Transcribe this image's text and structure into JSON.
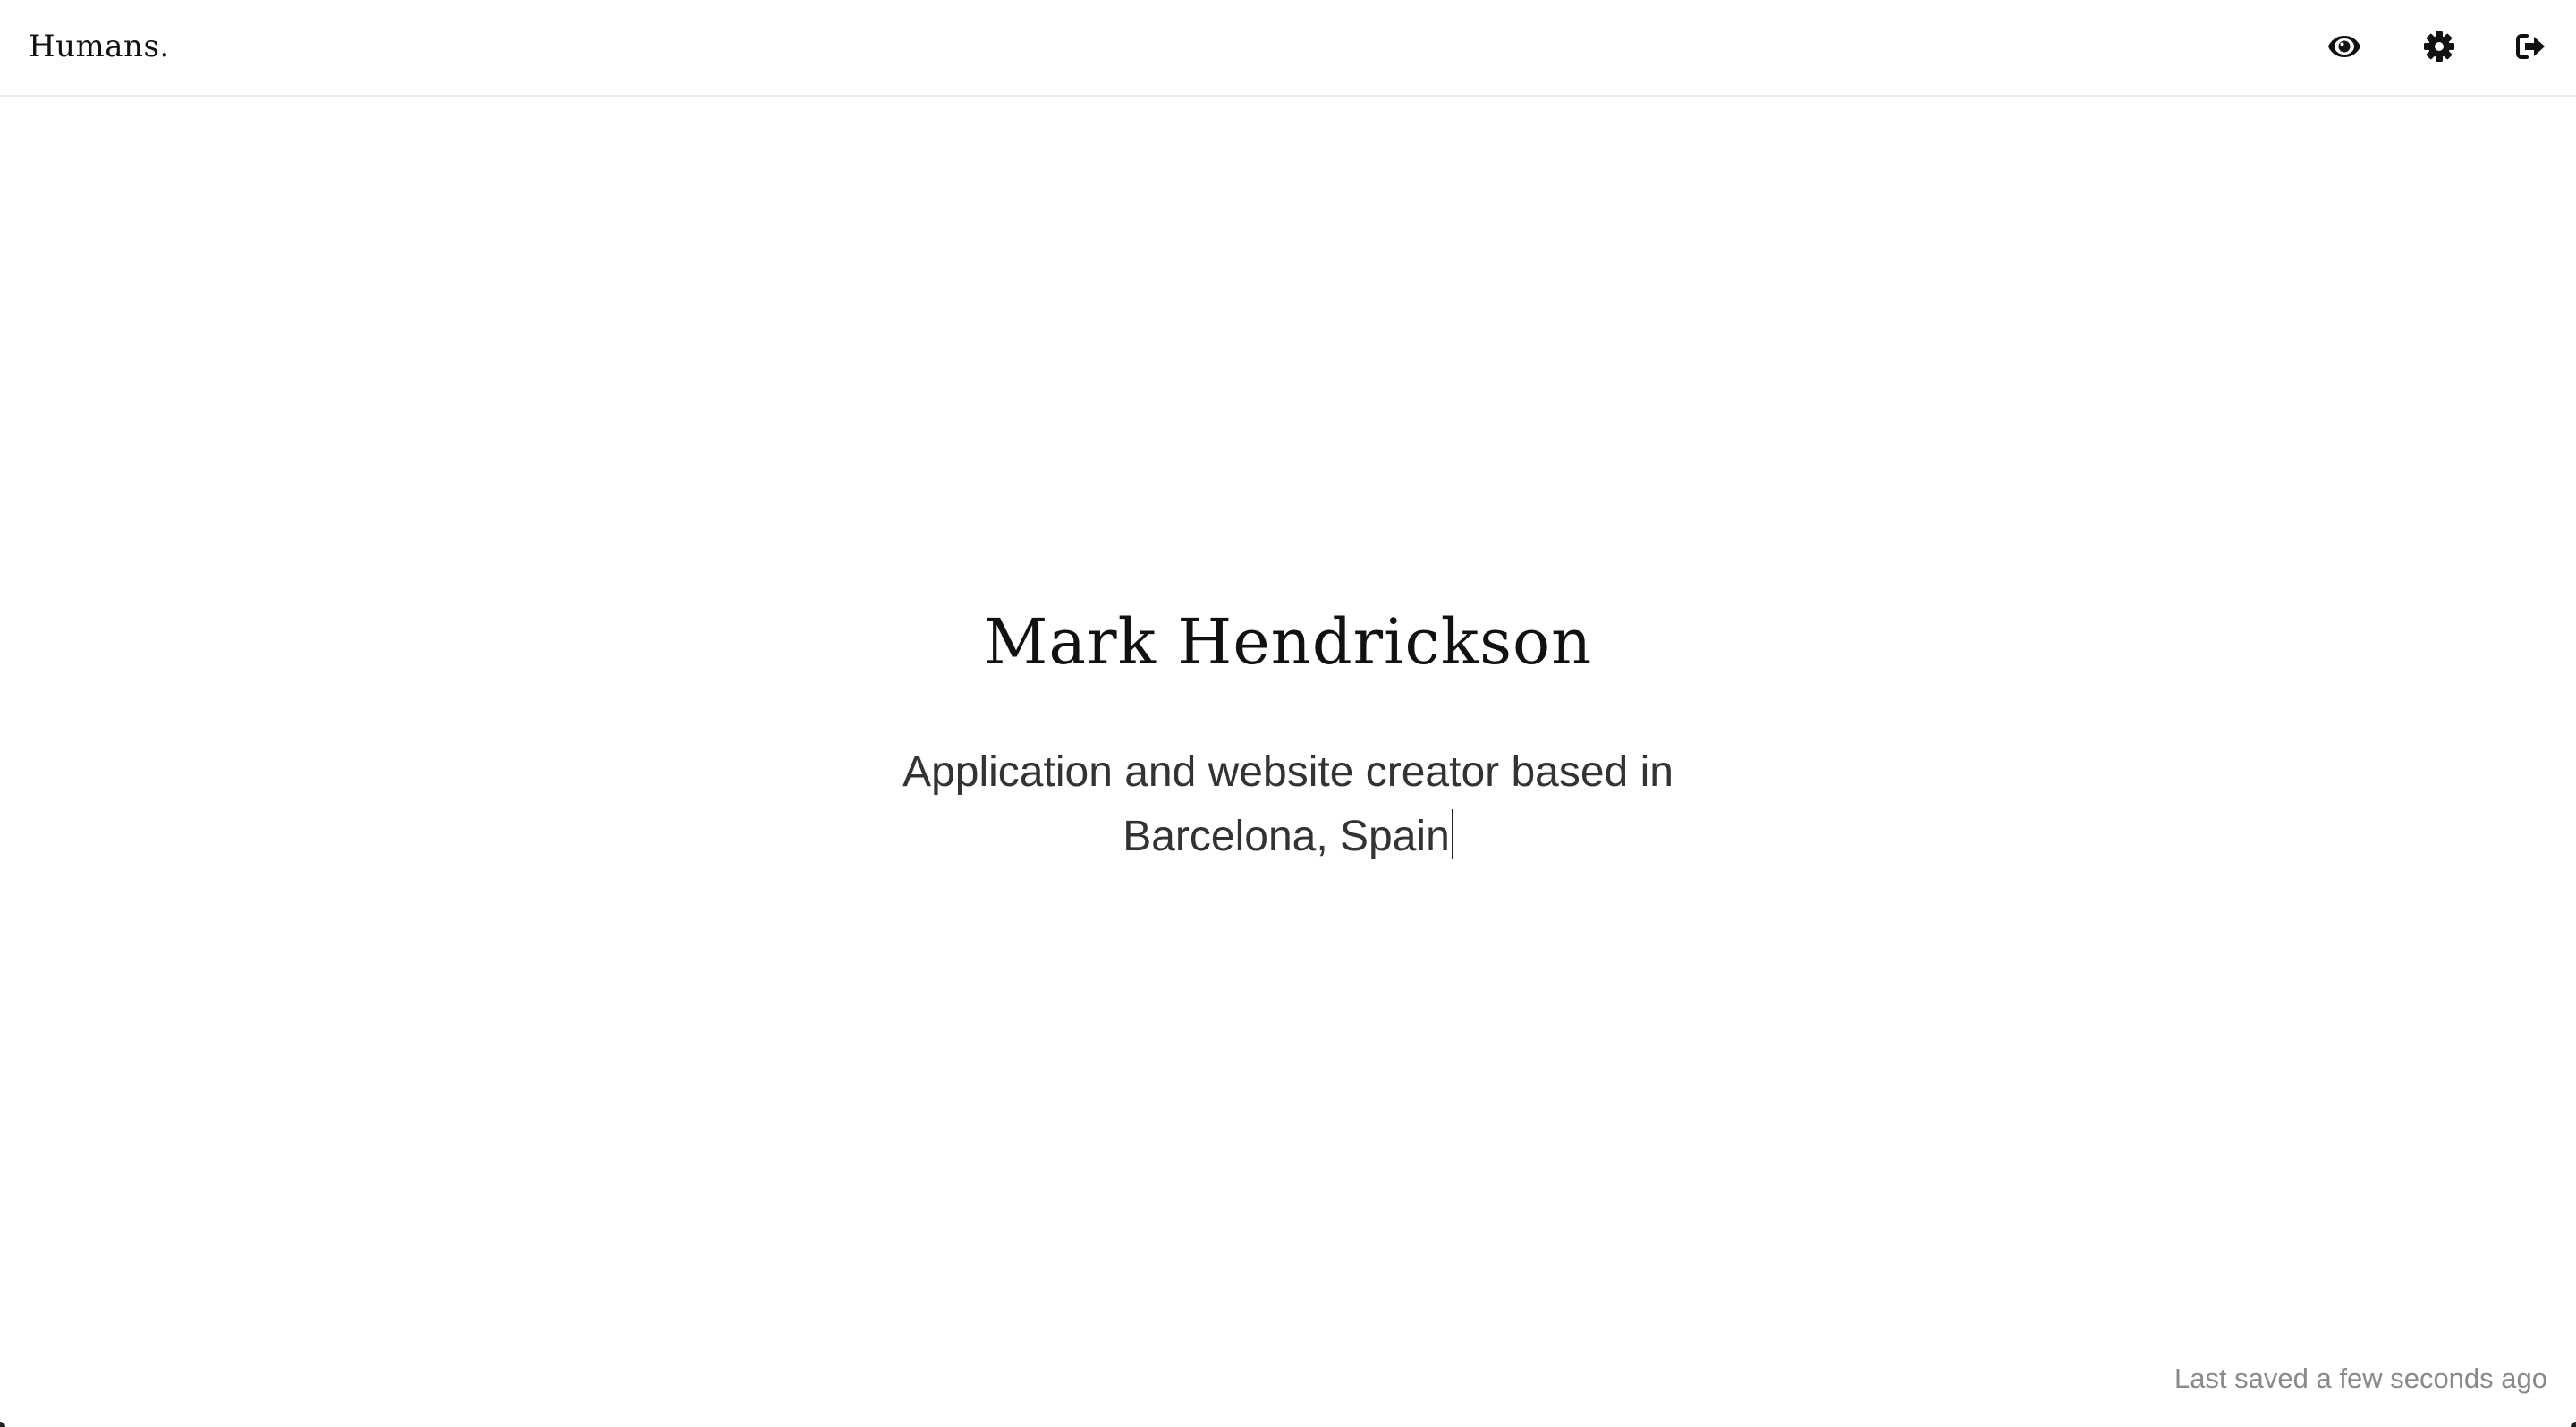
{
  "app": {
    "logo_text": "Humans."
  },
  "toolbar": {
    "preview_icon": "eye-icon",
    "settings_icon": "gear-icon",
    "logout_icon": "sign-out-icon"
  },
  "profile": {
    "name": "Mark Hendrickson",
    "bio_line1": "Application and website creator based in",
    "bio_line2": "Barcelona, Spain"
  },
  "status": {
    "saved_text": "Last saved a few seconds ago"
  },
  "colors": {
    "text_primary": "#111111",
    "text_secondary": "#333333",
    "muted": "#8a8a8a",
    "divider": "#ececec",
    "background": "#ffffff"
  }
}
